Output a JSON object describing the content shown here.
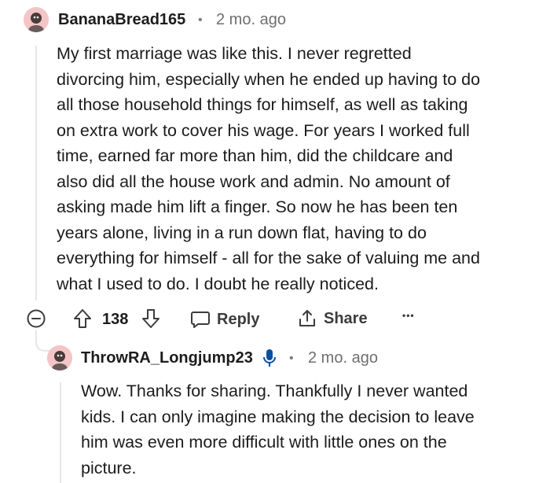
{
  "comment1": {
    "username": "BananaBread165",
    "separator": "•",
    "time": "2 mo. ago",
    "lines": [
      "My first marriage was like this. I never regretted",
      "divorcing him, especially when he ended up having to do",
      "all those household things for himself, as well as taking",
      "on extra work to cover his wage. For years I worked full",
      "time, earned far more than him, did the childcare and",
      "also did all the house work and admin. No amount of",
      "asking made him lift a finger. So now he has been ten",
      "years alone, living in a run down flat, having to do",
      "everything for himself - all for the sake of valuing me and",
      "what I used to do. I doubt he really noticed."
    ],
    "score": "138",
    "reply_label": "Reply",
    "share_label": "Share",
    "more_label": "•••",
    "avatar_color": "#f4c5c6"
  },
  "comment2": {
    "username": "ThrowRA_Longjump23",
    "separator": "•",
    "time": "2 mo. ago",
    "lines": [
      "Wow. Thanks for sharing. Thankfully I never wanted",
      "kids. I can only imagine making the decision to leave",
      "him was even more difficult with little ones on the",
      "picture."
    ],
    "badge_icon": "microphone-icon",
    "badge_color": "#0a4ea1"
  },
  "icons": {
    "collapse": "collapse-minus-icon",
    "upvote": "upvote-arrow-icon",
    "downvote": "downvote-arrow-icon",
    "reply": "reply-bubble-icon",
    "share": "share-upload-icon",
    "more": "more-dots-icon"
  }
}
